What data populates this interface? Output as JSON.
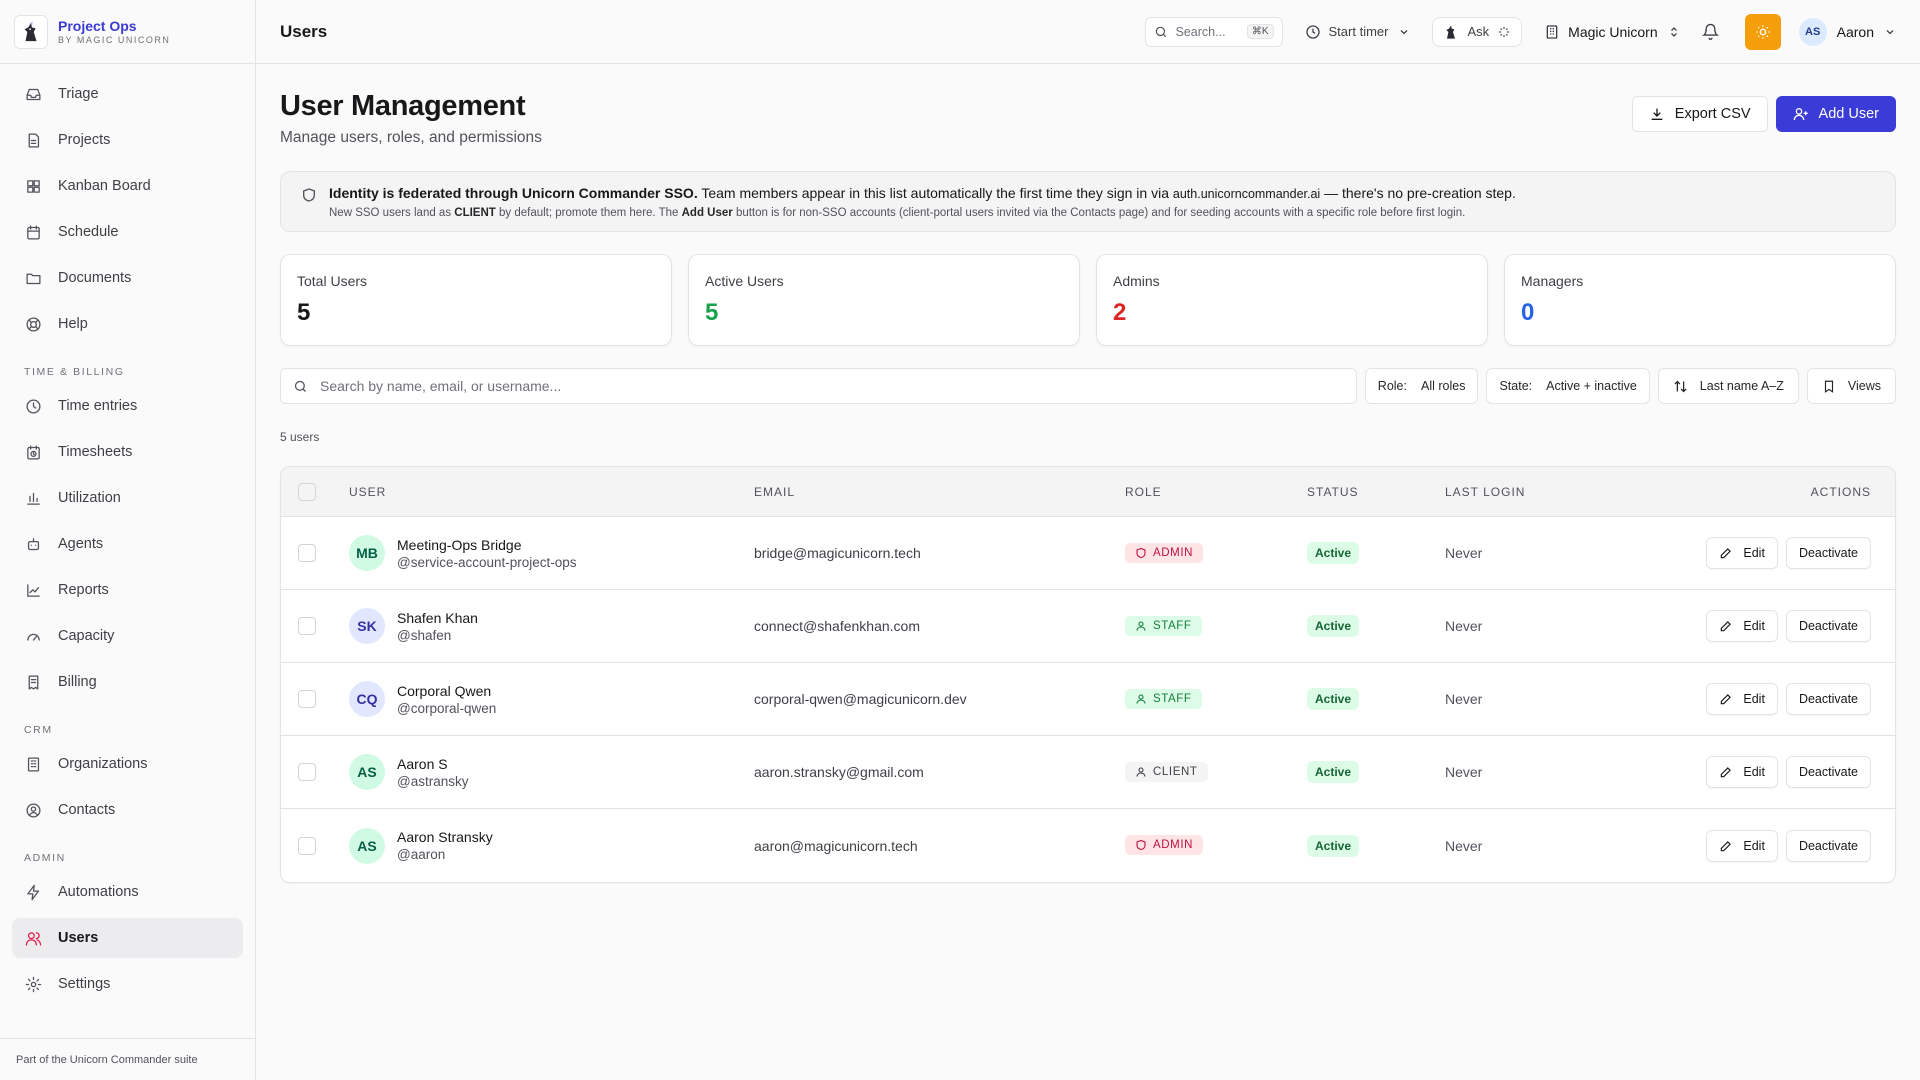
{
  "brand": {
    "name": "Project Ops",
    "sub": "BY MAGIC UNICORN"
  },
  "nav": {
    "items_main": [
      {
        "label": "Triage",
        "icon": "inbox-icon"
      },
      {
        "label": "Projects",
        "icon": "document-icon"
      },
      {
        "label": "Kanban Board",
        "icon": "grid-icon"
      },
      {
        "label": "Schedule",
        "icon": "calendar-icon"
      },
      {
        "label": "Documents",
        "icon": "folder-icon"
      },
      {
        "label": "Help",
        "icon": "lifebuoy-icon"
      }
    ],
    "section_time": "TIME & BILLING",
    "items_time": [
      {
        "label": "Time entries",
        "icon": "clock-icon"
      },
      {
        "label": "Timesheets",
        "icon": "calendar-clock-icon"
      },
      {
        "label": "Utilization",
        "icon": "bar-chart-icon"
      },
      {
        "label": "Agents",
        "icon": "bot-icon"
      },
      {
        "label": "Reports",
        "icon": "line-chart-icon"
      },
      {
        "label": "Capacity",
        "icon": "gauge-icon"
      },
      {
        "label": "Billing",
        "icon": "receipt-icon"
      }
    ],
    "section_crm": "CRM",
    "items_crm": [
      {
        "label": "Organizations",
        "icon": "building-icon"
      },
      {
        "label": "Contacts",
        "icon": "contact-icon"
      }
    ],
    "section_admin": "ADMIN",
    "items_admin": [
      {
        "label": "Automations",
        "icon": "bolt-icon"
      },
      {
        "label": "Users",
        "icon": "users-icon"
      },
      {
        "label": "Settings",
        "icon": "gear-icon"
      }
    ],
    "footer": "Part of the Unicorn Commander suite"
  },
  "topbar": {
    "title": "Users",
    "search_placeholder": "Search...",
    "search_shortcut": "⌘K",
    "timer_label": "Start timer",
    "ask_label": "Ask",
    "workspace": "Magic Unicorn",
    "user_initials": "AS",
    "user_name": "Aaron"
  },
  "page": {
    "title": "User Management",
    "subtitle": "Manage users, roles, and permissions",
    "export_label": "Export CSV",
    "add_label": "Add User"
  },
  "info": {
    "bold": "Identity is federated through Unicorn Commander SSO.",
    "text1": " Team members appear in this list automatically the first time they sign in via ",
    "domain": "auth.unicorncommander.ai",
    "text2": " — there's no pre-creation step.",
    "line2_a": "New SSO users land as ",
    "line2_client": "CLIENT",
    "line2_b": " by default; promote them here. The ",
    "line2_add": "Add User",
    "line2_c": " button is for non-SSO accounts (client-portal users invited via the Contacts page) and for seeding accounts with a specific role before first login."
  },
  "stats": [
    {
      "label": "Total Users",
      "value": "5",
      "color": "#18181b"
    },
    {
      "label": "Active Users",
      "value": "5",
      "color": "#16a34a"
    },
    {
      "label": "Admins",
      "value": "2",
      "color": "#dc2626"
    },
    {
      "label": "Managers",
      "value": "0",
      "color": "#2563eb"
    }
  ],
  "filters": {
    "search_placeholder": "Search by name, email, or username...",
    "role_label": "Role:",
    "role_value": "All roles",
    "state_label": "State:",
    "state_value": "Active + inactive",
    "sort_label": "Last name A–Z",
    "views_label": "Views"
  },
  "count_text": "5 users",
  "table": {
    "headers": {
      "user": "USER",
      "email": "EMAIL",
      "role": "ROLE",
      "status": "STATUS",
      "last_login": "LAST LOGIN",
      "actions": "ACTIONS"
    },
    "edit_label": "Edit",
    "deactivate_label": "Deactivate",
    "rows": [
      {
        "initials": "MB",
        "name": "Meeting-Ops Bridge",
        "handle": "@service-account-project-ops",
        "email": "bridge@magicunicorn.tech",
        "role": "ADMIN",
        "status": "Active",
        "last_login": "Never",
        "avatar_bg": "#d1fae5",
        "avatar_fg": "#065f46"
      },
      {
        "initials": "SK",
        "name": "Shafen Khan",
        "handle": "@shafen",
        "email": "connect@shafenkhan.com",
        "role": "STAFF",
        "status": "Active",
        "last_login": "Never",
        "avatar_bg": "#e0e7ff",
        "avatar_fg": "#3730a3"
      },
      {
        "initials": "CQ",
        "name": "Corporal Qwen",
        "handle": "@corporal-qwen",
        "email": "corporal-qwen@magicunicorn.dev",
        "role": "STAFF",
        "status": "Active",
        "last_login": "Never",
        "avatar_bg": "#e0e7ff",
        "avatar_fg": "#3730a3"
      },
      {
        "initials": "AS",
        "name": "Aaron S",
        "handle": "@astransky",
        "email": "aaron.stransky@gmail.com",
        "role": "CLIENT",
        "status": "Active",
        "last_login": "Never",
        "avatar_bg": "#d1fae5",
        "avatar_fg": "#065f46"
      },
      {
        "initials": "AS",
        "name": "Aaron Stransky",
        "handle": "@aaron",
        "email": "aaron@magicunicorn.tech",
        "role": "ADMIN",
        "status": "Active",
        "last_login": "Never",
        "avatar_bg": "#d1fae5",
        "avatar_fg": "#065f46"
      }
    ]
  },
  "colors": {
    "primary": "#3b3bd8",
    "admin_badge_bg": "#ffe4e6",
    "admin_badge_fg": "#be123c",
    "staff_badge_bg": "#dcfce7",
    "staff_badge_fg": "#15803d",
    "client_badge_bg": "#f4f4f5",
    "client_badge_fg": "#3f3f46",
    "status_bg": "#dcfce7",
    "status_fg": "#166534",
    "sun_button": "#f59e0b"
  }
}
